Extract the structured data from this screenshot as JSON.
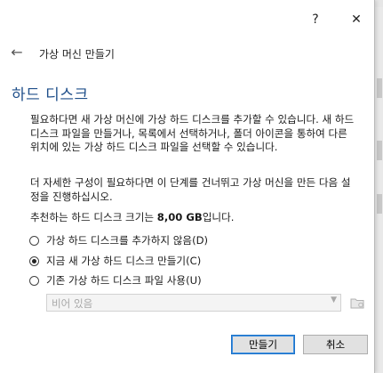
{
  "titlebar": {
    "help_glyph": "?",
    "close_glyph": "✕"
  },
  "wizard": {
    "back_glyph": "←",
    "title": "가상 머신 만들기",
    "section_title": "하드 디스크",
    "paragraph1": "필요하다면 새 가상 머신에 가상 하드 디스크를 추가할 수 있습니다. 새 하드 디스크 파일을 만들거나, 목록에서 선택하거나, 폴더 아이콘을 통하여 다른 위치에 있는 가상 하드 디스크 파일을 선택할 수 있습니다.",
    "paragraph2": "더 자세한 구성이 필요하다면 이 단계를 건너뛰고 가상 머신을 만든 다음 설정을 진행하십시오.",
    "recommend_prefix": "추천하는 하드 디스크 크기는 ",
    "recommend_size": "8,00 GB",
    "recommend_suffix": "입니다.",
    "options": [
      {
        "label": "가상 하드 디스크를 추가하지 않음(D)",
        "selected": false
      },
      {
        "label": "지금 새 가상 하드 디스크 만들기(C)",
        "selected": true
      },
      {
        "label": "기존 가상 하드 디스크 파일 사용(U)",
        "selected": false
      }
    ],
    "combo_value": "비어 있음",
    "combo_icon": "chevron-down-icon",
    "folder_icon": "folder-icon"
  },
  "buttons": {
    "create": "만들기",
    "cancel": "취소"
  },
  "colors": {
    "title_blue": "#1f4f8a",
    "primary_border": "#1d73c9"
  }
}
